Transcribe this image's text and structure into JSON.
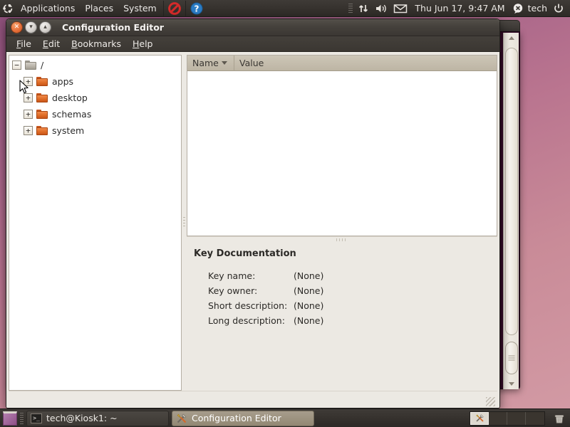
{
  "desktop": {
    "background_color": "#a05d86"
  },
  "top_panel": {
    "logo": "ubuntu-logo",
    "menus": [
      {
        "label": "Applications",
        "name": "applications-menu"
      },
      {
        "label": "Places",
        "name": "places-menu"
      },
      {
        "label": "System",
        "name": "system-menu"
      }
    ],
    "launchers": [
      {
        "name": "prohibited-icon",
        "title": "no-entry"
      },
      {
        "name": "help-icon",
        "title": "?"
      }
    ],
    "tray": {
      "network_icon": "network-transfer-icon",
      "volume_icon": "volume-icon",
      "mail_icon": "mail-icon",
      "clock": "Thu Jun 17,  9:47 AM",
      "user": "tech",
      "user_icon": "user-status-icon",
      "power_icon": "power-icon"
    }
  },
  "window": {
    "title": "Configuration Editor",
    "buttons": {
      "close": "close-button",
      "minimize": "minimize-button",
      "maximize": "maximize-button",
      "close_glyph": "✕",
      "minimize_glyph": "▾",
      "maximize_glyph": "▴"
    },
    "menubar": [
      {
        "label": "File",
        "mnemonic": "F",
        "rest": "ile"
      },
      {
        "label": "Edit",
        "mnemonic": "E",
        "rest": "dit"
      },
      {
        "label": "Bookmarks",
        "mnemonic": "B",
        "rest": "ookmarks"
      },
      {
        "label": "Help",
        "mnemonic": "H",
        "rest": "elp"
      }
    ],
    "tree": {
      "root": {
        "label": "/",
        "expander": "−",
        "icon": "folder-gray-icon",
        "expanded": true
      },
      "children": [
        {
          "label": "apps",
          "expander": "+",
          "icon": "folder-orange-icon"
        },
        {
          "label": "desktop",
          "expander": "+",
          "icon": "folder-orange-icon"
        },
        {
          "label": "schemas",
          "expander": "+",
          "icon": "folder-orange-icon"
        },
        {
          "label": "system",
          "expander": "+",
          "icon": "folder-orange-icon"
        }
      ]
    },
    "list": {
      "columns": [
        {
          "label": "Name",
          "sorted": "descending"
        },
        {
          "label": "Value",
          "sorted": "none"
        }
      ],
      "rows": []
    },
    "documentation": {
      "title": "Key Documentation",
      "fields": [
        {
          "label": "Key name:",
          "value": "(None)"
        },
        {
          "label": "Key owner:",
          "value": "(None)"
        },
        {
          "label": "Short description:",
          "value": "(None)"
        },
        {
          "label": "Long description:",
          "value": "(None)"
        }
      ]
    }
  },
  "background_window": {
    "type": "terminal",
    "background_color": "#300a24"
  },
  "bottom_panel": {
    "show_desktop": "show-desktop-button",
    "tasks": [
      {
        "label": "tech@Kiosk1: ~",
        "icon": "terminal-icon",
        "active": false
      },
      {
        "label": "Configuration Editor",
        "icon": "tools-icon",
        "active": true
      }
    ],
    "workspaces": {
      "count": 4,
      "active": 1
    },
    "trash": "trash-icon"
  }
}
